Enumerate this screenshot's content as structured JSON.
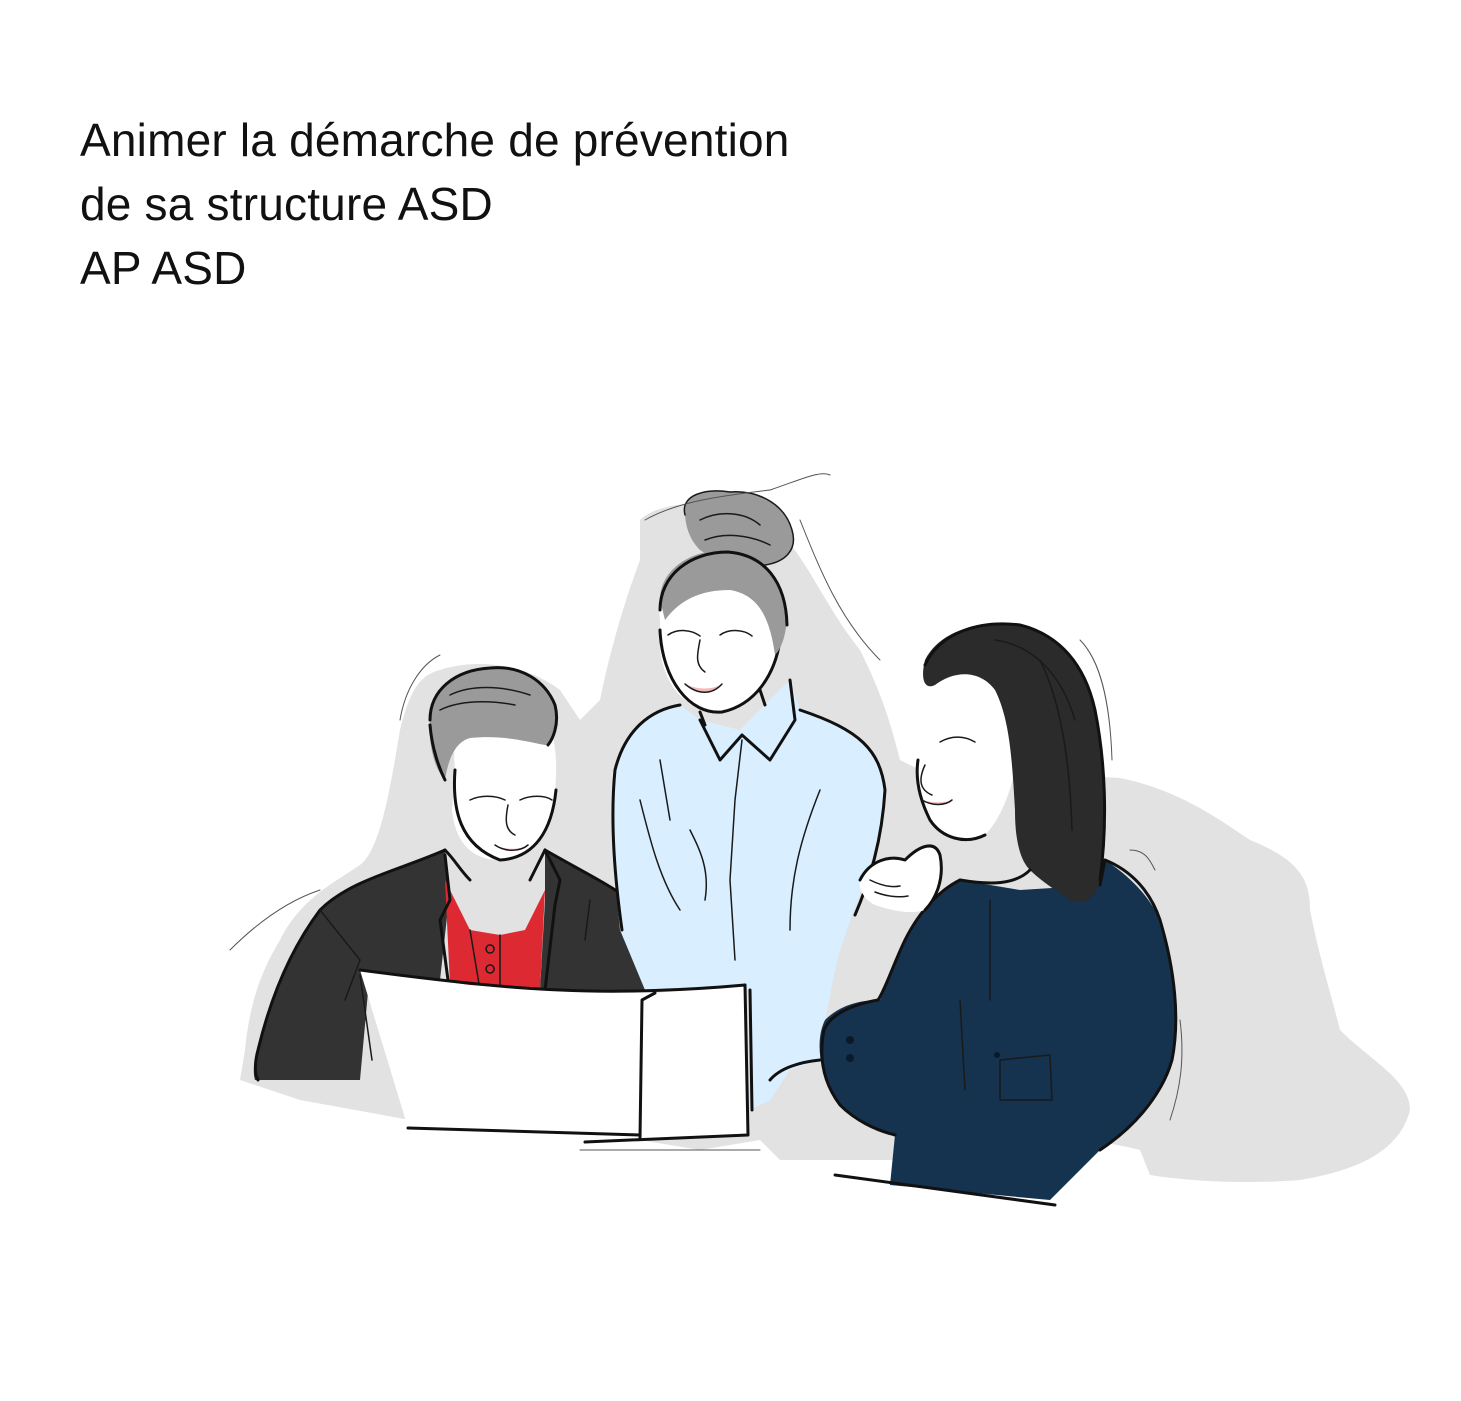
{
  "title": {
    "lines": [
      "Animer la démarche de prévention",
      "de sa structure ASD",
      "AP ASD"
    ]
  },
  "illustration": {
    "description_icon": "team-meeting-illustration",
    "colors": {
      "shadow": "#e2e2e2",
      "jacket_dark": "#333333",
      "polo_red": "#dd2a32",
      "shirt_light_blue": "#d9efff",
      "blouse_navy": "#15324f",
      "hair_gray": "#9a9a9a",
      "hair_black": "#2b2b2b",
      "skin": "#ffffff",
      "laptop": "#ffffff"
    }
  }
}
